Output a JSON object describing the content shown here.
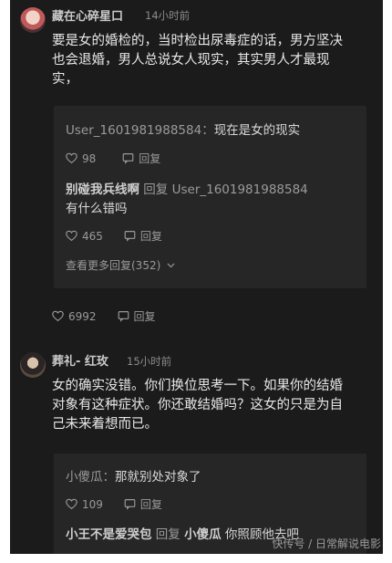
{
  "comment1": {
    "author": "藏在心碎星口",
    "time": "14小时前",
    "text_lines": [
      "要是女的婚检的，当时检出尿毒症的话，男方坚决",
      "也会退婚，男人总说女人现实，其实男人才最现",
      "实，"
    ],
    "replies": [
      {
        "author": "User_1601981988584",
        "separator": "：",
        "text": "现在是女的现实",
        "likes": "98",
        "reply_label": "回复"
      },
      {
        "author": "别碰我兵线啊",
        "reply_word": "回复",
        "target": "User_1601981988584",
        "text": "有什么错吗",
        "likes": "465",
        "reply_label": "回复"
      }
    ],
    "more_replies": "查看更多回复(352)",
    "likes": "6992",
    "reply_label": "回复"
  },
  "comment2": {
    "author": "葬礼- 红玫",
    "time": "15小时前",
    "text_lines": [
      "女的确实没错。你们换位思考一下。如果你的结婚",
      "对象有这种症状。你还敢结婚吗？这女的只是为自",
      "己未来着想而已。"
    ],
    "replies": [
      {
        "author": "小傻瓜",
        "separator": "：",
        "text": "那就别处对象了",
        "likes": "109",
        "reply_label": "回复"
      },
      {
        "author": "小王不是爱哭包",
        "reply_word": "回复",
        "target": "小傻瓜",
        "text": "你照顾他去吧"
      }
    ]
  },
  "watermark": "快传号 / 日常解说电影",
  "icons": {
    "like": "heart-icon",
    "reply": "comment-bubble-icon",
    "more": "chevron-down-icon"
  }
}
